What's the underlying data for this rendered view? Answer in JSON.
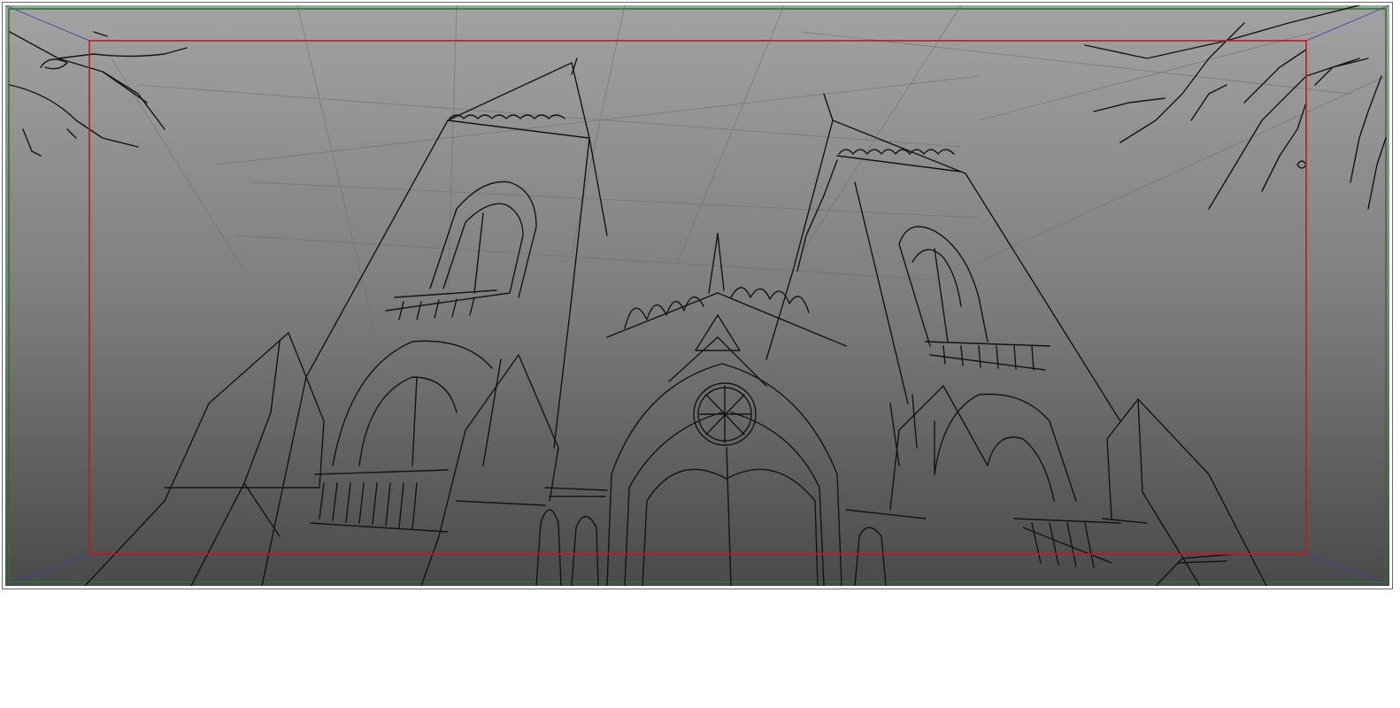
{
  "canvas": {
    "subject": "gothic-cathedral-perspective-sketch",
    "background_gradient": [
      "#a2a2a2",
      "#7e7e7e",
      "#4a4a4a"
    ],
    "frame_guide_color": "#c8161c",
    "outer_guide_color": "#1e7a24",
    "perspective_guide_color": "#3c3cb4",
    "sketch_line_color": "#141414",
    "construction_line_color": "#6e6e6e"
  }
}
